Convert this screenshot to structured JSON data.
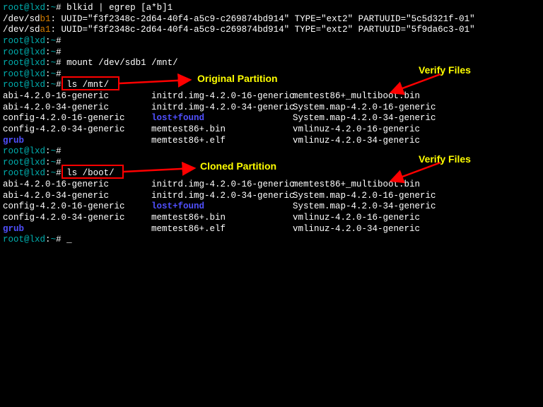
{
  "prompt": {
    "user": "root",
    "host": "lxd",
    "sep": "@",
    "path": "~",
    "suffix": "# "
  },
  "commands": {
    "blkid": "blkid | egrep [a*b]1",
    "mount": "mount /dev/sdb1 /mnt/",
    "lsmnt": "ls /mnt/",
    "lsboot": "ls /boot/"
  },
  "blkid_out": {
    "line1_prefix": "/dev/sd",
    "line1_dev": "b1",
    "line2_dev": "a1",
    "uuid_part": ": UUID=\"f3f2348c-2d64-40f4-a5c9-c269874bd914\" TYPE=\"ext2\" PARTUUID=\"",
    "part1": "5c5d321f-01\"",
    "part2": "5f9da6c3-01\""
  },
  "listing": {
    "rows": [
      {
        "c1": "abi-4.2.0-16-generic",
        "c2": "initrd.img-4.2.0-16-generic",
        "c3": "memtest86+_multiboot.bin"
      },
      {
        "c1": "abi-4.2.0-34-generic",
        "c2": "initrd.img-4.2.0-34-generic",
        "c3": "System.map-4.2.0-16-generic"
      },
      {
        "c1": "config-4.2.0-16-generic",
        "c2": "lost+found",
        "c3": "System.map-4.2.0-34-generic",
        "c2blue": true
      },
      {
        "c1": "config-4.2.0-34-generic",
        "c2": "memtest86+.bin",
        "c3": "vmlinuz-4.2.0-16-generic"
      },
      {
        "c1": "grub",
        "c2": "memtest86+.elf",
        "c3": "vmlinuz-4.2.0-34-generic",
        "c1blue": true
      }
    ]
  },
  "annotations": {
    "original": "Original Partition",
    "cloned": "Cloned Partition",
    "verify": "Verify Files"
  },
  "cursor": "_"
}
